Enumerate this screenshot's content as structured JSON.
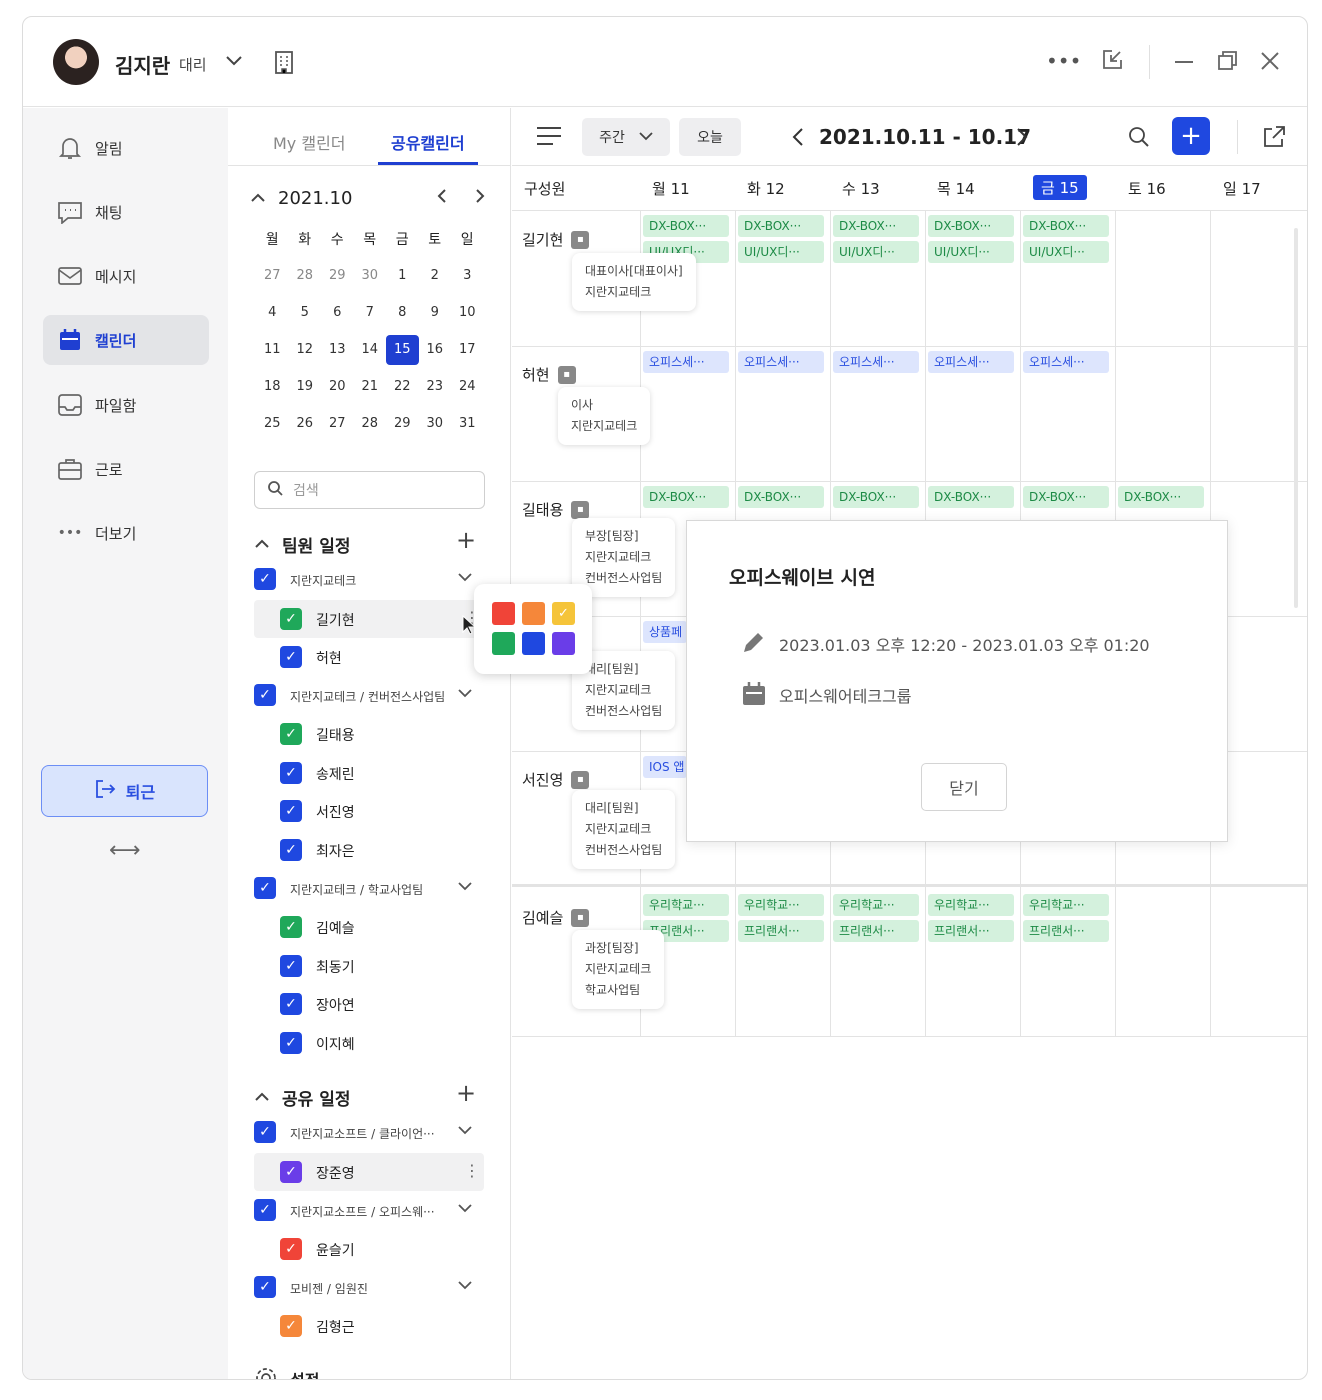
{
  "user": {
    "name": "김지란",
    "rank": "대리"
  },
  "nav": {
    "items": [
      {
        "label": "알림"
      },
      {
        "label": "채팅"
      },
      {
        "label": "메시지"
      },
      {
        "label": "캘린더"
      },
      {
        "label": "파일함"
      },
      {
        "label": "근로"
      },
      {
        "label": "더보기"
      }
    ],
    "leave": "퇴근"
  },
  "tabs": {
    "my": "My 캘린더",
    "shared": "공유캘린더"
  },
  "mini": {
    "title": "2021.10",
    "weekdays": [
      "월",
      "화",
      "수",
      "목",
      "금",
      "토",
      "일"
    ],
    "weeks": [
      [
        "27",
        "28",
        "29",
        "30",
        "1",
        "2",
        "3"
      ],
      [
        "4",
        "5",
        "6",
        "7",
        "8",
        "9",
        "10"
      ],
      [
        "11",
        "12",
        "13",
        "14",
        "15",
        "16",
        "17"
      ],
      [
        "18",
        "19",
        "20",
        "21",
        "22",
        "23",
        "24"
      ],
      [
        "25",
        "26",
        "27",
        "28",
        "29",
        "30",
        "31"
      ]
    ],
    "selected": "15"
  },
  "search": {
    "placeholder": "검색"
  },
  "team": {
    "title": "팀원 일정",
    "groups": [
      {
        "label": "지란지교테크",
        "members": [
          "길기현",
          "허현"
        ]
      },
      {
        "label": "지란지교테크 / 컨버전스사업팀",
        "members": [
          "길태용",
          "송제린",
          "서진영",
          "최자은"
        ]
      },
      {
        "label": "지란지교테크 / 학교사업팀",
        "members": [
          "김예슬",
          "최동기",
          "장아연",
          "이지혜"
        ]
      }
    ]
  },
  "shared": {
    "title": "공유 일정",
    "groups": [
      {
        "label": "지란지교소프트 / 클라이언···",
        "members": [
          "장준영"
        ]
      },
      {
        "label": "지란지교소프트 / 오피스웨···",
        "members": [
          "윤슬기"
        ]
      },
      {
        "label": "모비젠 / 임원진",
        "members": [
          "김형근"
        ]
      }
    ]
  },
  "settings": "설정",
  "toolbar": {
    "view": "주간",
    "today": "오늘",
    "range": "2021.10.11 - 10.17"
  },
  "days": {
    "member_col": "구성원",
    "list": [
      "월 11",
      "화 12",
      "수 13",
      "목 14",
      "금 15",
      "토 16",
      "일 17"
    ]
  },
  "rows": [
    {
      "name": "길기현",
      "tip": [
        "대표이사[대표이사]",
        "지란지교테크"
      ],
      "ev1": "DX-BOX···",
      "ev2": "UI/UX디···"
    },
    {
      "name": "허현",
      "tip": [
        "이사",
        "지란지교테크"
      ],
      "ev1": "오피스세···"
    },
    {
      "name": "길태용",
      "tip": [
        "부장[팀장]",
        "지란지교테크",
        "컨버전스사업팀"
      ],
      "ev1": "DX-BOX···"
    },
    {
      "name": "",
      "tip": [
        "대리[팀원]",
        "지란지교테크",
        "컨버전스사업팀"
      ],
      "ev1": "상품페"
    },
    {
      "name": "서진영",
      "tip": [
        "대리[팀원]",
        "지란지교테크",
        "컨버전스사업팀"
      ],
      "ev1": "IOS 앱"
    },
    {
      "name": "김예슬",
      "tip": [
        "과장[팀장]",
        "지란지교테크",
        "학교사업팀"
      ],
      "ev1": "우리학교···",
      "ev2": "프리랜서···"
    }
  ],
  "popup": {
    "title": "오피스웨이브 시연",
    "time": "2023.01.03 오후 12:20 - 2023.01.03 오후 01:20",
    "calendar": "오피스웨어테크그룹",
    "close": "닫기"
  },
  "colors": {
    "accent": "#1f48e0",
    "green": "#1fa85a",
    "red": "#f04438",
    "orange": "#f5873a",
    "yellow": "#f5c43a",
    "purple": "#6a3de8"
  }
}
